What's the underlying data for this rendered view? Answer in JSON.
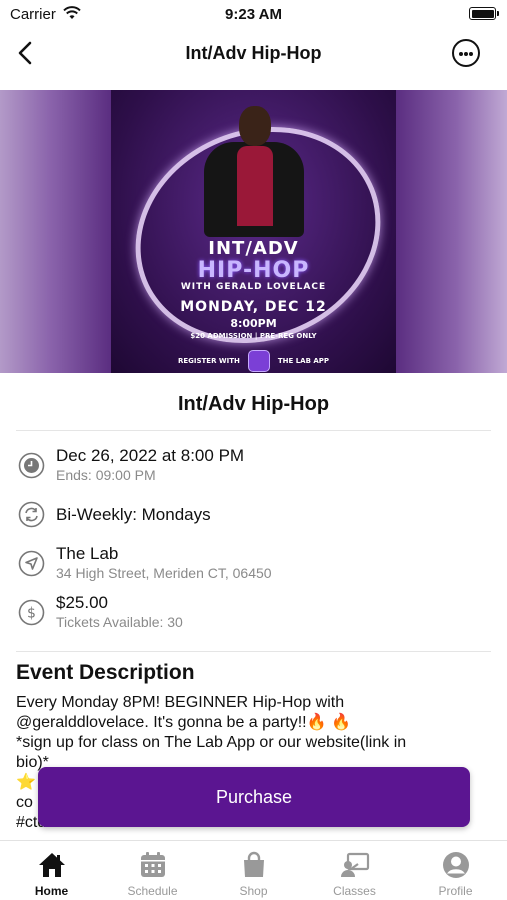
{
  "status_bar": {
    "carrier": "Carrier",
    "time": "9:23 AM"
  },
  "nav": {
    "title": "Int/Adv Hip-Hop"
  },
  "poster": {
    "line1": "INT/ADV",
    "line2": "HIP-HOP",
    "line3": "WITH GERALD LOVELACE",
    "line4": "MONDAY, DEC 12",
    "line5": "8:00PM",
    "line6": "$20 ADMISSION | PRE-REG ONLY",
    "register_left": "REGISTER WITH",
    "register_right": "THE LAB APP"
  },
  "event": {
    "title": "Int/Adv Hip-Hop",
    "date": "Dec 26, 2022 at 8:00 PM",
    "ends": "Ends: 09:00 PM",
    "recurrence": "Bi-Weekly: Mondays",
    "venue": "The Lab",
    "address": "34 High Street, Meriden CT, 06450",
    "price": "$25.00",
    "tickets": "Tickets Available: 30"
  },
  "description": {
    "heading": "Event Description",
    "lines": [
      "Every Monday 8PM! BEGINNER Hip-Hop with",
      "@geralddlovelace. It's gonna be a party!!🔥 🔥",
      "*sign up for class on The Lab App or our website(link in",
      "bio)*",
      "⭐",
      "co",
      "#ctdancers #thelabct #ctcreatives #ctartists"
    ]
  },
  "purchase_label": "Purchase",
  "tabs": [
    {
      "label": "Home",
      "icon": "home-icon",
      "active": true
    },
    {
      "label": "Schedule",
      "icon": "calendar-icon",
      "active": false
    },
    {
      "label": "Shop",
      "icon": "shopping-bag-icon",
      "active": false
    },
    {
      "label": "Classes",
      "icon": "classes-icon",
      "active": false
    },
    {
      "label": "Profile",
      "icon": "profile-icon",
      "active": false
    }
  ],
  "colors": {
    "accent": "#5b1591",
    "muted_text": "#8a8a8a",
    "inactive_tab": "#999999"
  }
}
